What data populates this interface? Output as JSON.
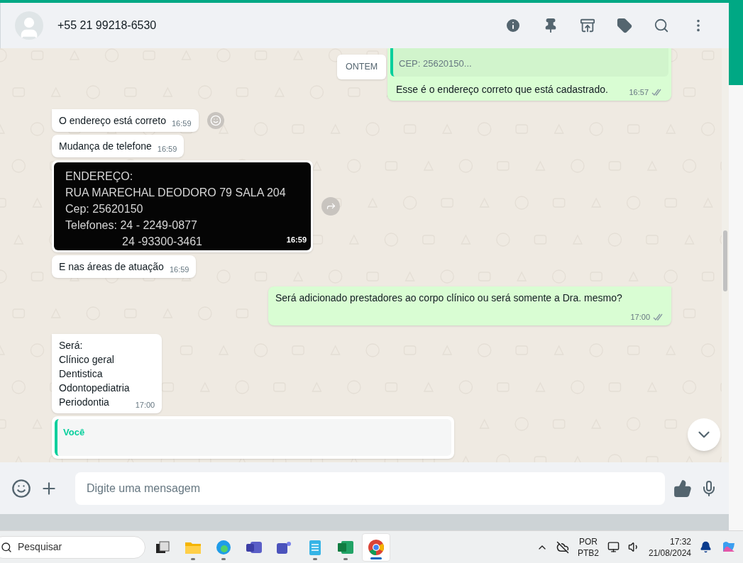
{
  "header": {
    "contact": "+55 21 99218-6530"
  },
  "date_pill": "ONTEM",
  "messages": [
    {
      "kind": "out_quoted",
      "tail": false,
      "quote_lines": [
        "CEP: 25620150..."
      ],
      "text": "Esse é o endereço correto que está cadastrado.",
      "time": "16:57"
    },
    {
      "kind": "in",
      "tail": true,
      "lines": [
        "O endereço está correto"
      ],
      "time": "16:59",
      "reaction_button": true
    },
    {
      "kind": "in",
      "tail": false,
      "lines": [
        "Mudança de telefone"
      ],
      "time": "16:59"
    },
    {
      "kind": "image",
      "tail": false,
      "image_lines": [
        "ENDEREÇO:",
        "RUA MARECHAL DEODORO 79 SALA 204",
        "Cep: 25620150",
        "Telefones: 24 - 2249-0877"
      ],
      "image_continuation": "24 -93300-3461",
      "time": "16:59",
      "forward_button": true
    },
    {
      "kind": "in",
      "tail": false,
      "lines": [
        "E nas áreas de atuação"
      ],
      "time": "16:59"
    },
    {
      "kind": "out",
      "tail": true,
      "text": "Será adicionado prestadores ao corpo clínico ou será somente a Dra. mesmo?",
      "time": "17:00"
    },
    {
      "kind": "in",
      "tail": true,
      "lines": [
        "Será:",
        "Clínico geral",
        "Dentistica",
        "Odontopediatria",
        "Periodontia"
      ],
      "time": "17:00"
    },
    {
      "kind": "reply",
      "tail": false,
      "quote_author": "Você"
    }
  ],
  "composer": {
    "placeholder": "Digite uma mensagem"
  },
  "taskbar": {
    "search_placeholder": "Pesquisar",
    "apps": [
      {
        "kind": "taskview",
        "selected": false,
        "running": false
      },
      {
        "kind": "folder",
        "selected": false,
        "running": true
      },
      {
        "kind": "edge",
        "selected": false,
        "running": true
      },
      {
        "kind": "teams_work",
        "selected": false,
        "running": false
      },
      {
        "kind": "teams",
        "selected": false,
        "running": false
      },
      {
        "kind": "notepad",
        "selected": false,
        "running": true
      },
      {
        "kind": "excel",
        "selected": false,
        "running": true
      },
      {
        "kind": "chrome",
        "selected": true,
        "running": true
      }
    ],
    "language": [
      "POR",
      "PTB2"
    ],
    "time": "17:32",
    "date": "21/08/2024"
  }
}
